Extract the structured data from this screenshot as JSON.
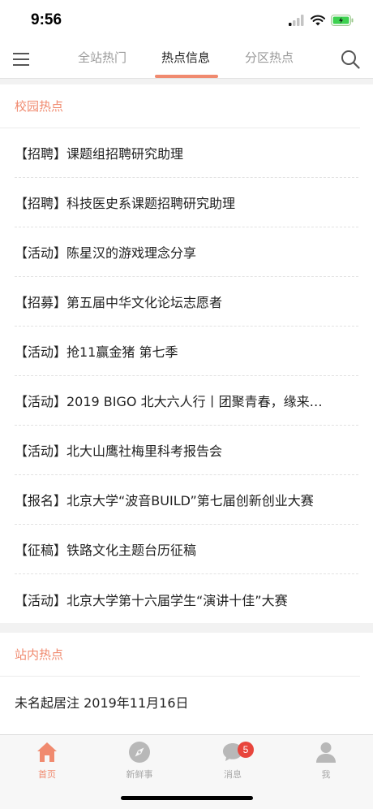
{
  "status_bar": {
    "time": "9:56"
  },
  "nav": {
    "tabs": [
      {
        "label": "全站热门",
        "active": false
      },
      {
        "label": "热点信息",
        "active": true
      },
      {
        "label": "分区热点",
        "active": false
      }
    ]
  },
  "campus_section": {
    "title": "校园热点",
    "items": [
      "【招聘】课题组招聘研究助理",
      "【招聘】科技医史系课题招聘研究助理",
      "【活动】陈星汉的游戏理念分享",
      "【招募】第五届中华文化论坛志愿者",
      "【活动】抢11赢金猪 第七季",
      "【活动】2019 BIGO 北大六人行丨团聚青春，缘来…",
      "【活动】北大山鹰社梅里科考报告会",
      "【报名】北京大学“波音BUILD”第七届创新创业大赛",
      "【征稿】铁路文化主题台历征稿",
      "【活动】北京大学第十六届学生“演讲十佳”大赛"
    ]
  },
  "site_section": {
    "title": "站内热点",
    "items": [
      "未名起居注 2019年11月16日"
    ]
  },
  "tab_bar": {
    "items": [
      {
        "label": "首页",
        "icon": "home-icon",
        "active": true
      },
      {
        "label": "新鲜事",
        "icon": "compass-icon",
        "active": false
      },
      {
        "label": "消息",
        "icon": "message-icon",
        "active": false,
        "badge": "5"
      },
      {
        "label": "我",
        "icon": "profile-icon",
        "active": false
      }
    ]
  },
  "colors": {
    "accent": "#f08a6f",
    "badge": "#e8453c"
  }
}
